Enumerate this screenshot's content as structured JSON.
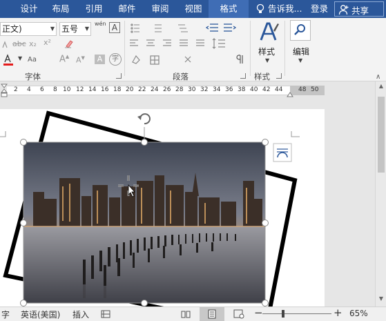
{
  "tabs": [
    {
      "label": "设计"
    },
    {
      "label": "布局"
    },
    {
      "label": "引用"
    },
    {
      "label": "邮件"
    },
    {
      "label": "审阅"
    },
    {
      "label": "视图"
    },
    {
      "label": "格式"
    }
  ],
  "header": {
    "tell_me": "告诉我...",
    "login": "登录",
    "share": "共享"
  },
  "ribbon": {
    "font_name": "正文)",
    "font_size": "五号",
    "font_group_label": "字体",
    "paragraph_group_label": "段落",
    "styles_group_label": "样式",
    "styles_button": "样式",
    "edit_button": "编辑",
    "wen_label": "wén",
    "abc_label": "abc"
  },
  "ruler": {
    "numbers": [
      "2",
      "4",
      "6",
      "8",
      "10",
      "12",
      "14",
      "16",
      "18",
      "20",
      "22",
      "24",
      "26",
      "28",
      "30",
      "32",
      "34",
      "36",
      "38",
      "40",
      "42",
      "44"
    ],
    "dark_numbers": [
      "48",
      "50"
    ]
  },
  "status": {
    "word_count_tail": "字",
    "language": "英语(美国)",
    "insert_mode": "插入",
    "zoom": "65%"
  },
  "colors": {
    "title_blue": "#2b579a",
    "active_tab": "#3f6db5",
    "font_color_red": "#e41b1b"
  }
}
